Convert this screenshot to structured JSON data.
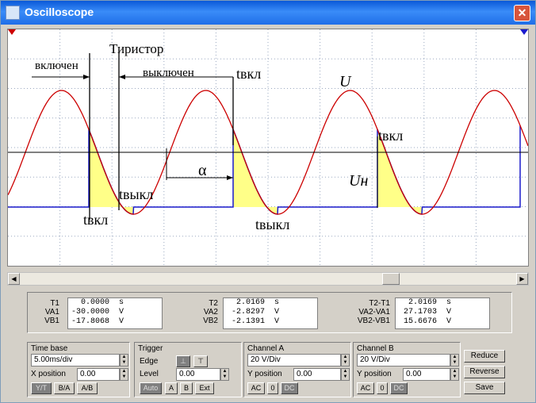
{
  "window": {
    "title": "Oscilloscope",
    "close_glyph": "✕"
  },
  "screen": {
    "annotations": {
      "thyristor": "Тиристор",
      "on": "включен",
      "off": "выключен",
      "t_on": "tвкл",
      "t_off": "tвыкл",
      "U": "U",
      "Un": "Uн",
      "alpha": "α"
    },
    "colors": {
      "signal": "#cc0000",
      "load": "#1a1acc",
      "fill": "#ffff88",
      "grid": "#9aa8c0"
    }
  },
  "readout": {
    "col1": {
      "labels": [
        "T1",
        "VA1",
        "VB1"
      ],
      "values": [
        "  0.0000  s",
        "-30.0000  V",
        "-17.8068  V"
      ]
    },
    "col2": {
      "labels": [
        "T2",
        "VA2",
        "VB2"
      ],
      "values": [
        "  2.0169  s",
        " -2.8297  V",
        " -2.1391  V"
      ]
    },
    "col3": {
      "labels": [
        "T2-T1",
        "VA2-VA1",
        "VB2-VB1"
      ],
      "values": [
        "  2.0169  s",
        " 27.1703  V",
        " 15.6676  V"
      ]
    }
  },
  "timebase": {
    "title": "Time base",
    "scale": "5.00ms/div",
    "xpos_label": "X position",
    "xpos": "0.00",
    "buttons": [
      "Y/T",
      "B/A",
      "A/B"
    ]
  },
  "trigger": {
    "title": "Trigger",
    "edge_label": "Edge",
    "level_label": "Level",
    "level": "0.00",
    "buttons": [
      "Auto",
      "A",
      "B",
      "Ext"
    ]
  },
  "channelA": {
    "title": "Channel A",
    "scale": "20 V/Div",
    "ypos_label": "Y position",
    "ypos": "0.00",
    "buttons": [
      "AC",
      "0",
      "DC"
    ]
  },
  "channelB": {
    "title": "Channel B",
    "scale": "20 V/Div",
    "ypos_label": "Y position",
    "ypos": "0.00",
    "buttons": [
      "AC",
      "0",
      "DC"
    ]
  },
  "side_buttons": [
    "Reduce",
    "Reverse",
    "Save"
  ]
}
